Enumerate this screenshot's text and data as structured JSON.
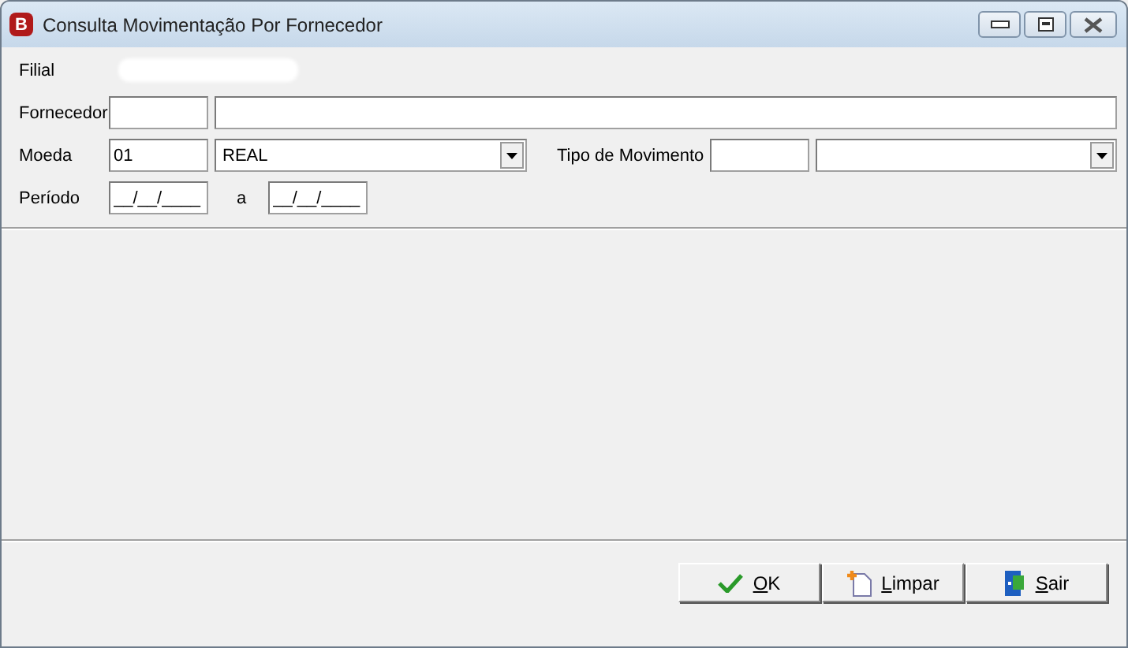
{
  "window": {
    "title": "Consulta Movimentação Por Fornecedor",
    "app_icon": "B"
  },
  "form": {
    "filial": {
      "label": "Filial"
    },
    "fornecedor": {
      "label": "Fornecedor"
    },
    "moeda": {
      "label": "Moeda",
      "code": "01",
      "value": "REAL"
    },
    "tipo_movimento": {
      "label": "Tipo de Movimento"
    },
    "periodo": {
      "label": "Período",
      "from": "__/__/____",
      "separator": "a",
      "to": "__/__/____"
    }
  },
  "buttons": [
    {
      "kind": "ok",
      "label": "OK"
    },
    {
      "kind": "clear",
      "label": "Limpar"
    },
    {
      "kind": "exit",
      "label": "Sair"
    }
  ]
}
